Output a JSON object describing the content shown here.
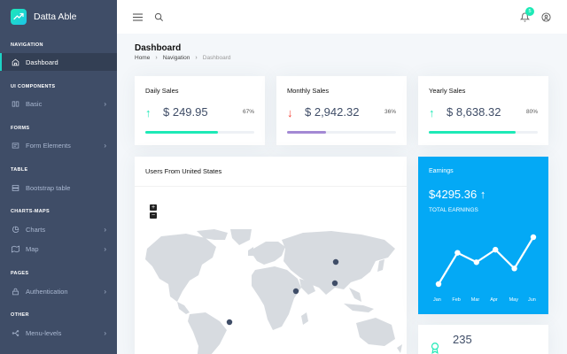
{
  "brand": {
    "name": "Datta Able"
  },
  "sidebar": {
    "sections": [
      {
        "caption": "NAVIGATION",
        "items": [
          {
            "label": "Dashboard",
            "icon": "home-icon",
            "active": true
          }
        ]
      },
      {
        "caption": "UI COMPONENTS",
        "items": [
          {
            "label": "Basic",
            "icon": "box-icon"
          }
        ]
      },
      {
        "caption": "FORMS",
        "items": [
          {
            "label": "Form Elements",
            "icon": "file-text-icon"
          }
        ]
      },
      {
        "caption": "TABLE",
        "items": [
          {
            "label": "Bootstrap table",
            "icon": "server-icon"
          }
        ]
      },
      {
        "caption": "CHARTS-MAPS",
        "items": [
          {
            "label": "Charts",
            "icon": "pie-chart-icon"
          },
          {
            "label": "Map",
            "icon": "map-icon"
          }
        ]
      },
      {
        "caption": "PAGES",
        "items": [
          {
            "label": "Authentication",
            "icon": "lock-icon"
          }
        ]
      },
      {
        "caption": "OTHER",
        "items": [
          {
            "label": "Menu-levels",
            "icon": "menu-levels-icon"
          }
        ]
      }
    ]
  },
  "header": {
    "notification_count": "5"
  },
  "page": {
    "title": "Dashboard",
    "breadcrumb": [
      "Home",
      "Navigation",
      "Dashboard"
    ]
  },
  "stats": [
    {
      "title": "Daily Sales",
      "value": "$ 249.95",
      "percent": "67%",
      "progress": 0.67,
      "trend": "up",
      "color": "#1de9b6"
    },
    {
      "title": "Monthly Sales",
      "value": "$ 2,942.32",
      "percent": "36%",
      "progress": 0.36,
      "trend": "down",
      "color": "#a389d4"
    },
    {
      "title": "Yearly Sales",
      "value": "$ 8,638.32",
      "percent": "80%",
      "progress": 0.8,
      "trend": "up",
      "color": "#1de9b6"
    }
  ],
  "map_card": {
    "title": "Users From United States",
    "zoom_in": "+",
    "zoom_out": "−"
  },
  "earnings": {
    "label": "Earnings",
    "value": "$4295.36",
    "sublabel": "TOTAL EARNINGS",
    "accent": "#04a9f5",
    "months": [
      "Jan",
      "Feb",
      "Mar",
      "Apr",
      "May",
      "Jun"
    ],
    "values": [
      0,
      10,
      7,
      11,
      5,
      15
    ]
  },
  "mini_card": {
    "value": "235"
  },
  "colors": {
    "sidebar": "#3f4d67",
    "green": "#1de9b6",
    "red": "#f44236",
    "purple": "#a389d4"
  }
}
